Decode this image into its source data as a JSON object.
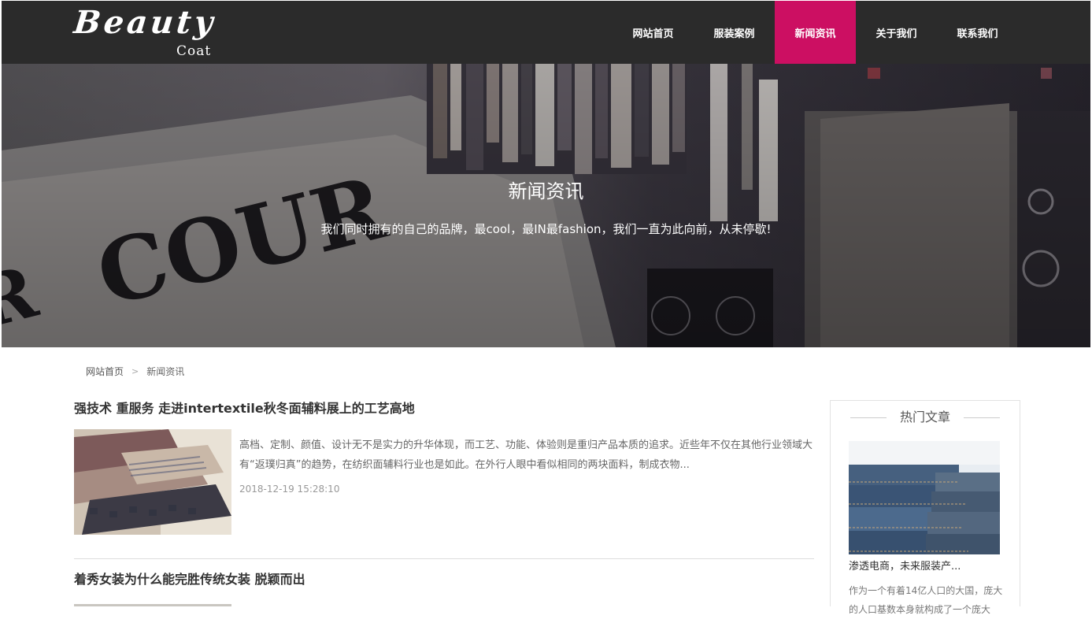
{
  "logo": {
    "main": "Beauty",
    "sub": "Coat"
  },
  "nav": {
    "items": [
      {
        "label": "网站首页"
      },
      {
        "label": "服装案例"
      },
      {
        "label": "新闻资讯"
      },
      {
        "label": "关于我们"
      },
      {
        "label": "联系我们"
      }
    ],
    "active_index": 2
  },
  "banner": {
    "title": "新闻资讯",
    "subtitle": "我们同时拥有的自己的品牌，最cool，最IN最fashion，我们一直为此向前，从未停歇!"
  },
  "breadcrumb": {
    "home": "网站首页",
    "separator": ">",
    "current": "新闻资讯"
  },
  "articles": [
    {
      "title": "强技术 重服务 走进intertextile秋冬面辅料展上的工艺高地",
      "summary": "高档、定制、颜值、设计无不是实力的升华体现，而工艺、功能、体验则是重归产品本质的追求。近些年不仅在其他行业领域大有“返璞归真”的趋势，在纺织面辅料行业也是如此。在外行人眼中看似相同的两块面料，制成衣物...",
      "date": "2018-12-19 15:28:10"
    },
    {
      "title": "着秀女装为什么能完胜传统女装 脱颖而出"
    }
  ],
  "sidebar": {
    "heading": "热门文章",
    "article": {
      "title": "渗透电商，未来服装产...",
      "summary": "作为一个有着14亿人口的大国，庞大的人口基数本身就构成了一个庞大"
    }
  },
  "colors": {
    "header_bg": "#2b2b2b",
    "nav_active": "#cc0f62"
  }
}
